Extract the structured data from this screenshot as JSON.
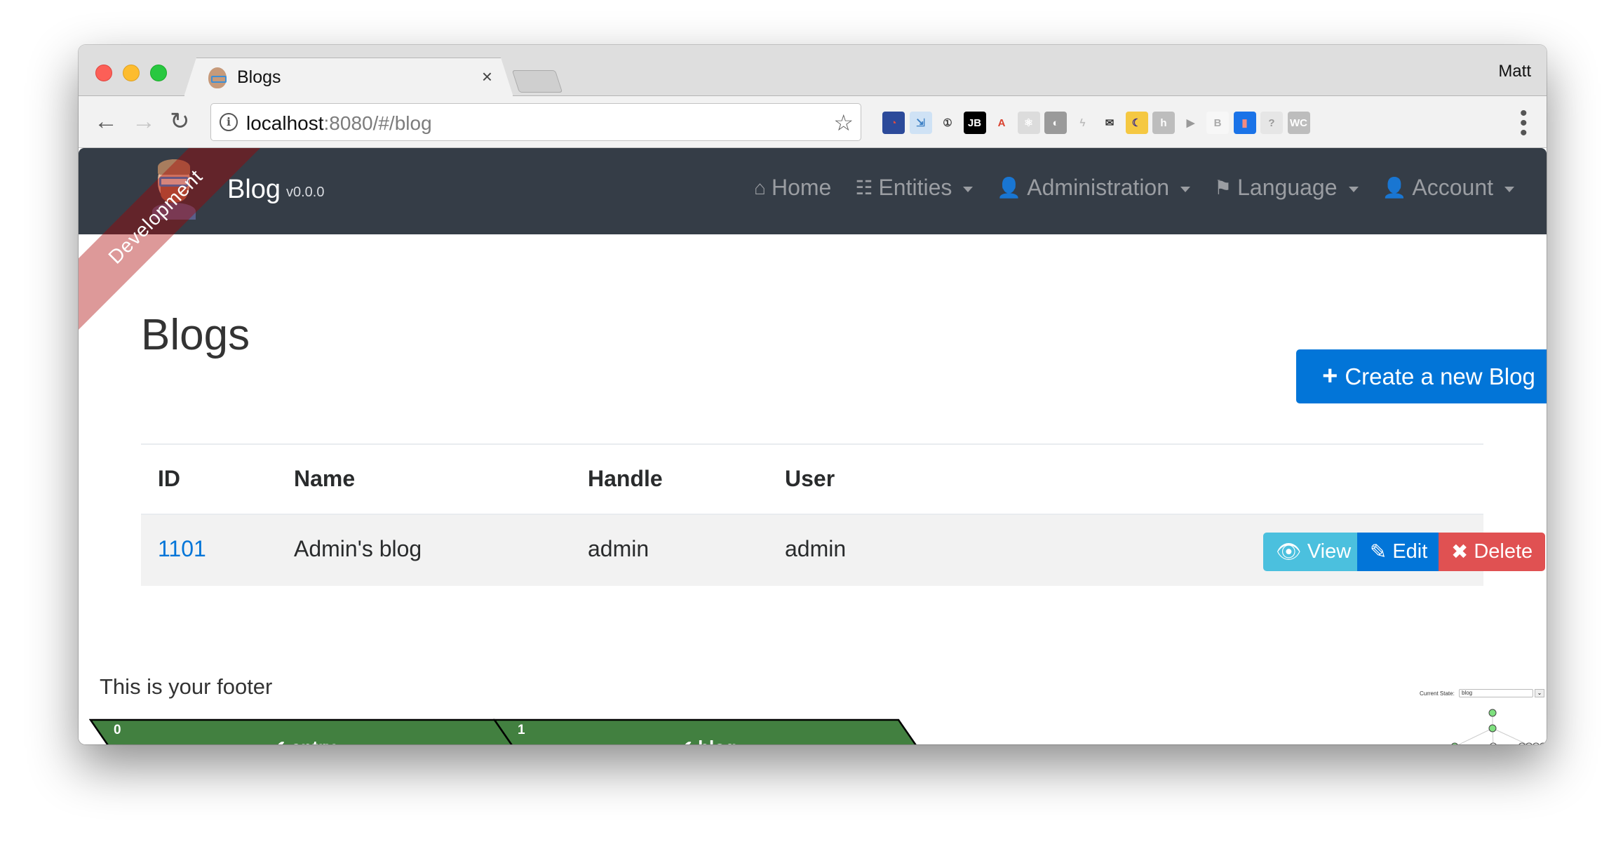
{
  "browser": {
    "tab_title": "Blogs",
    "tab_close": "×",
    "profile_name": "Matt",
    "url_host": "localhost",
    "url_rest": ":8080/#/blog",
    "back_icon": "←",
    "forward_icon": "→",
    "reload_icon": "↻",
    "star_icon": "☆",
    "extensions": [
      {
        "name": "speedometer-extension-icon",
        "glyph": "◔",
        "bg": "#2c4a9a",
        "fg": "#e84b3c"
      },
      {
        "name": "window-resizer-extension-icon",
        "glyph": "⇲",
        "bg": "#cfe2f5",
        "fg": "#3b7fc4"
      },
      {
        "name": "onepassword-extension-icon",
        "glyph": "①",
        "bg": "#f2f2f2",
        "fg": "#444"
      },
      {
        "name": "jetbrains-extension-icon",
        "glyph": "JB",
        "bg": "#000000",
        "fg": "#ffffff"
      },
      {
        "name": "font-a-extension-icon",
        "glyph": "A",
        "bg": "#f2f2f2",
        "fg": "#d9412e"
      },
      {
        "name": "react-devtools-extension-icon",
        "glyph": "⚛",
        "bg": "#dcdcdc",
        "fg": "#fff"
      },
      {
        "name": "ghostery-extension-icon",
        "glyph": "◐",
        "bg": "#9a9a9a",
        "fg": "#fff"
      },
      {
        "name": "lightning-extension-icon",
        "glyph": "ϟ",
        "bg": "#f2f2f2",
        "fg": "#bbb"
      },
      {
        "name": "mail-check-extension-icon",
        "glyph": "✉",
        "bg": "#f2f2f2",
        "fg": "#333"
      },
      {
        "name": "moon-extension-icon",
        "glyph": "☾",
        "bg": "#f5c842",
        "fg": "#3a2a8a"
      },
      {
        "name": "h-extension-icon",
        "glyph": "h",
        "bg": "#bdbdbd",
        "fg": "#fff"
      },
      {
        "name": "video-extension-icon",
        "glyph": "▶",
        "bg": "#f2f2f2",
        "fg": "#999"
      },
      {
        "name": "b-extension-icon",
        "glyph": "B",
        "bg": "#f7f7f7",
        "fg": "#aaa"
      },
      {
        "name": "lighthouse-extension-icon",
        "glyph": "▮",
        "bg": "#1a73e8",
        "fg": "#f28b82"
      },
      {
        "name": "help-extension-icon",
        "glyph": "?",
        "bg": "#e6e6e6",
        "fg": "#999"
      },
      {
        "name": "wc-extension-icon",
        "glyph": "WC",
        "bg": "#bdbdbd",
        "fg": "#fff"
      }
    ],
    "menu_icon": "⋮"
  },
  "navbar": {
    "brand_name": "Blog",
    "version": "v0.0.0",
    "ribbon": "Development",
    "items": [
      {
        "label": "Home",
        "icon": "⌂",
        "icon_name": "home-icon",
        "dropdown": false
      },
      {
        "label": "Entities",
        "icon": "☷",
        "icon_name": "list-icon",
        "dropdown": true
      },
      {
        "label": "Administration",
        "icon": "👤",
        "icon_name": "user-plus-icon",
        "dropdown": true
      },
      {
        "label": "Language",
        "icon": "⚑",
        "icon_name": "flag-icon",
        "dropdown": true
      },
      {
        "label": "Account",
        "icon": "👤",
        "icon_name": "user-icon",
        "dropdown": true
      }
    ]
  },
  "main": {
    "title": "Blogs",
    "create_button": {
      "icon": "+",
      "label": "Create a new Blog"
    },
    "table": {
      "headers": [
        "ID",
        "Name",
        "Handle",
        "User"
      ],
      "rows": [
        {
          "id": "1101",
          "name": "Admin's blog",
          "handle": "admin",
          "user": "admin"
        }
      ],
      "actions": [
        {
          "label": "View",
          "icon": "👁"
        },
        {
          "label": "Edit",
          "icon": "✎"
        },
        {
          "label": "Delete",
          "icon": "✖"
        }
      ]
    }
  },
  "footer": {
    "text": "This is your footer"
  },
  "transitions": [
    {
      "index": "0",
      "name": "entry",
      "status": "success",
      "check": "✔"
    },
    {
      "index": "1",
      "name": "blog",
      "status": "success",
      "check": "✔"
    }
  ],
  "state_visualizer": {
    "label": "Current State:",
    "selected": "blog",
    "toggle": "⌄"
  },
  "colors": {
    "navbar_bg": "#353d47",
    "primary": "#0275d8",
    "info": "#4bc0de",
    "danger": "#e05152",
    "transition_green": "#428040"
  }
}
